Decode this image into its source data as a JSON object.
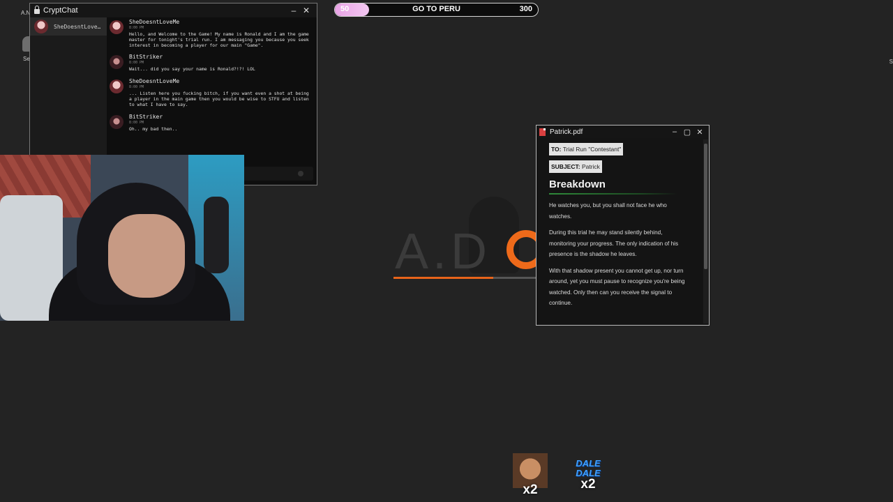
{
  "desktop": {
    "icons": [
      {
        "label": "A.N",
        "icon": "file-icon"
      },
      {
        "label": "Sect",
        "icon": "shield-icon"
      },
      {
        "label": "S",
        "icon": "file-icon"
      }
    ]
  },
  "progress_bar": {
    "current": "50",
    "title": "GO TO PERU",
    "goal": "300",
    "fraction": 0.167,
    "fill_color": "#e9a3e6"
  },
  "background_logo": {
    "text": "A.D"
  },
  "cryptchat": {
    "title": "CryptChat",
    "contact": "SheDoesntLove…",
    "messages": [
      {
        "author": "SheDoesntLoveMe",
        "time": "8:00 PM",
        "text": "Hello, and Welcome to the Game! My name is Ronald and I am the game master for tonight's trial run. I am messaging you because you seek interest in becoming a player for our main \"Game\"."
      },
      {
        "author": "BitStriker",
        "time": "8:00 PM",
        "text": "Wait... did you say your name is Ronald?!?! LOL"
      },
      {
        "author": "SheDoesntLoveMe",
        "time": "8:00 PM",
        "text": "... Listen here you fucking bitch, if you want even a shot at being a player in the main game then you would be wise to STFU and listen to what I have to say."
      },
      {
        "author": "BitStriker",
        "time": "8:00 PM",
        "text": "Oh.. my bad then.."
      }
    ]
  },
  "pdf": {
    "title": "Patrick.pdf",
    "to_label": "TO:",
    "to_value": "Trial Run \"Contestant\"",
    "subject_label": "SUBJECT:",
    "subject_value": "Patrick",
    "heading": "Breakdown",
    "paragraphs": [
      "He watches you, but you shall not face he who watches.",
      "During this trial he may stand silently behind, monitoring your progress. The only indication of his presence is the shadow he leaves.",
      "With that shadow present you cannot get up, nor turn around, yet you must pause to recognize you're being watched. Only then can you receive the signal to continue."
    ]
  },
  "emotes": [
    {
      "name": "laughing-man-emote",
      "multiplier": "x2"
    },
    {
      "name": "dale-dale-emote",
      "text": "DALE DALE",
      "multiplier": "x2"
    }
  ]
}
